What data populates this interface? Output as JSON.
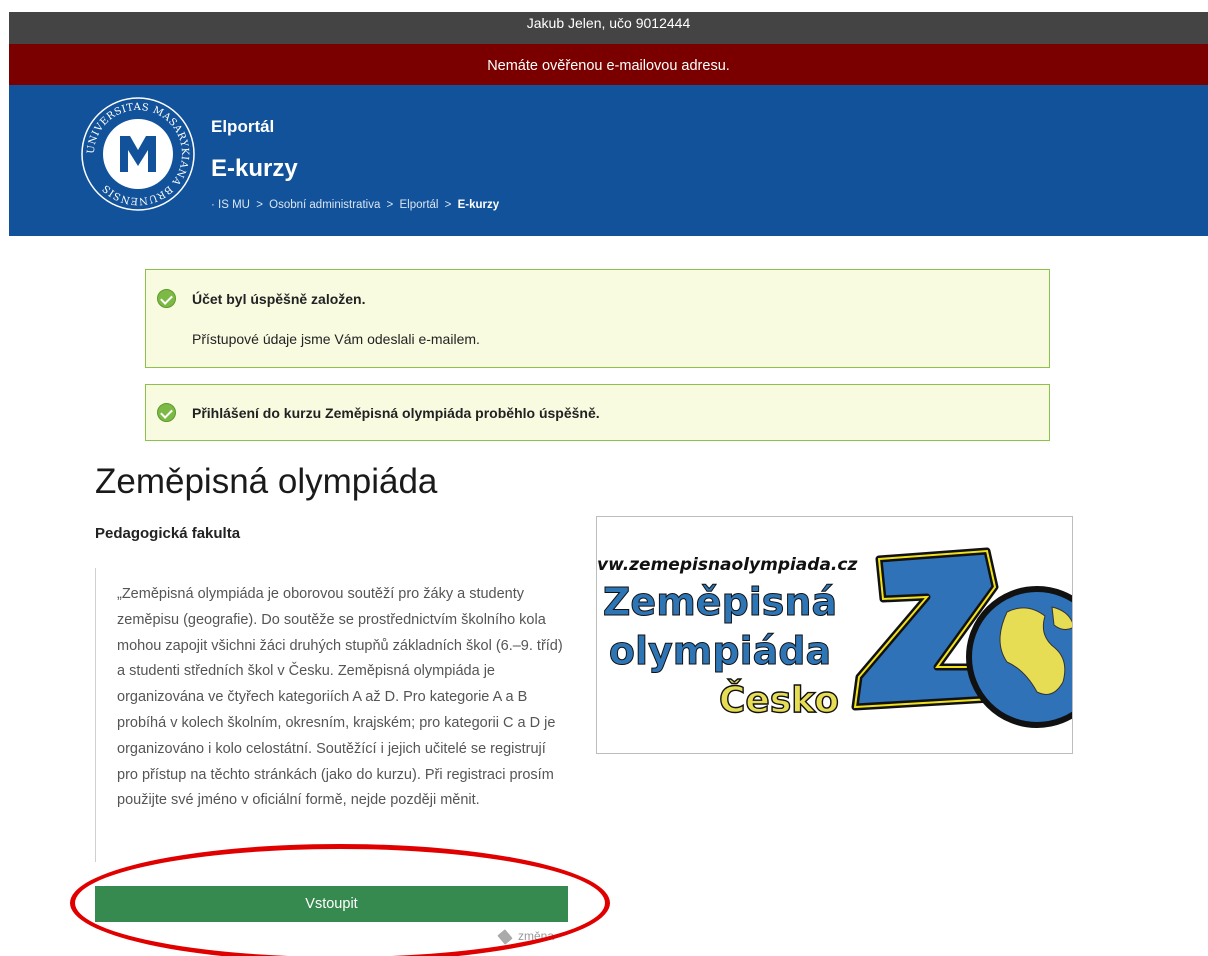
{
  "user_bar": {
    "text": "Jakub Jelen, učo 9012444"
  },
  "alert_bar": {
    "text": "Nemáte ověřenou e-mailovou adresu."
  },
  "header": {
    "app_name": "Elportál",
    "app_title": "E-kurzy",
    "logo_text": "UNIVERSITAS MASARYKIANA BRUNENSIS",
    "breadcrumb": {
      "prefix": "·",
      "items": [
        "IS MU",
        "Osobní administrativa",
        "Elportál",
        "E-kurzy"
      ],
      "separator": ">"
    }
  },
  "notices": [
    {
      "title": "Účet byl úspěšně založen.",
      "text": "Přístupové údaje jsme Vám odeslali e-mailem."
    },
    {
      "title": "Přihlášení do kurzu Zeměpisná olympiáda proběhlo úspěšně."
    }
  ],
  "course": {
    "title": "Zeměpisná olympiáda",
    "faculty": "Pedagogická fakulta",
    "description": "„Zeměpisná olympiáda je oborovou soutěží pro žáky a studenty zeměpisu (geografie). Do soutěže se prostřednictvím školního kola mohou zapojit všichni žáci druhých stupňů základních škol (6.–9. tříd) a studenti středních škol v Česku. Zeměpisná olympiáda je organizována ve čtyřech kategoriích A až D. Pro kategorie A a B probíhá v kolech školním, okresním, krajském; pro kategorii C a D je organizováno i kolo celostátní. Soutěžící i jejich učitelé se registrují pro přístup na těchto stránkách (jako do kurzu). Při registraci prosím použijte své jméno v oficiální formě, nejde později měnit.",
    "enter_button": "Vstoupit",
    "change_link": "změna",
    "image": {
      "url_text": "vw.zemepisnaolympiada.cz",
      "line1": "Zeměpisná",
      "line2": "olympiáda",
      "line3": "Česko",
      "mark": "ZO"
    }
  },
  "colors": {
    "user_bar": "#444444",
    "alert_bar": "#7a0000",
    "header": "#11529a",
    "notice_border": "#8bc34a",
    "notice_bg": "#f9fbe1",
    "button": "#378a4f",
    "annotation": "#e00000"
  }
}
